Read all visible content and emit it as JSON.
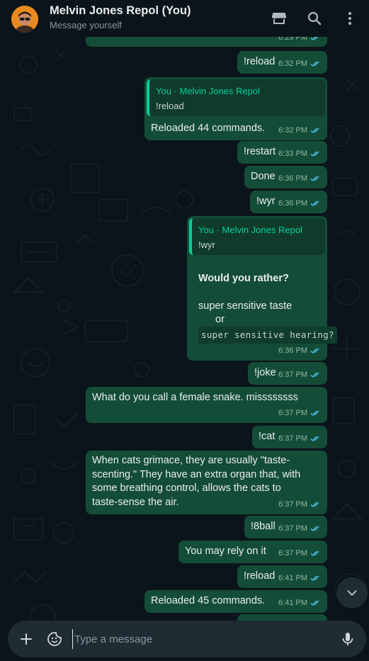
{
  "header": {
    "title": "Melvin Jones Repol (You)",
    "subtitle": "Message yourself",
    "icons": [
      "shop-icon",
      "search-icon",
      "more-vert-icon"
    ]
  },
  "colors": {
    "background": "#0b141a",
    "outgoing_bubble": "#144d37",
    "accent": "#06cf9c",
    "read_ticks": "#53bdeb",
    "composer": "#1f2c33"
  },
  "messages": [
    {
      "time": "6:29 PM"
    },
    {
      "text": "!reload",
      "time": "6:32 PM"
    },
    {
      "quote_author": "You · Melvin Jones Repol",
      "quote_text": "!reload",
      "text": "Reloaded 44 commands.",
      "time": "6:32 PM"
    },
    {
      "text": "!restart",
      "time": "6:33 PM"
    },
    {
      "text": "Done",
      "time": "6:36 PM"
    },
    {
      "text": "!wyr",
      "time": "6:36 PM"
    },
    {
      "quote_author": "You · Melvin Jones Repol",
      "quote_text": "!wyr",
      "title": "Would you rather?",
      "option_a": "super sensitive taste",
      "or": "or",
      "option_b": "super  sensitive  hearing?",
      "time": "6:36 PM"
    },
    {
      "text": "!joke",
      "time": "6:37 PM"
    },
    {
      "text": "What do you call a female snake. missssssss",
      "time": "6:37 PM"
    },
    {
      "text": "!cat",
      "time": "6:37 PM"
    },
    {
      "lines": [
        "When cats grimace, they are usually \"taste-",
        "scenting.\" They have an extra organ that, with",
        "some breathing control, allows the cats to",
        "taste-sense the air."
      ],
      "time": "6:37 PM"
    },
    {
      "text": "!8ball",
      "time": "6:37 PM"
    },
    {
      "text": "You may rely on it",
      "time": "6:37 PM"
    },
    {
      "text": "!reload",
      "time": "6:41 PM"
    },
    {
      "text": "Reloaded 45 commands.",
      "time": "6:41 PM"
    }
  ],
  "composer": {
    "placeholder": "Type a message",
    "icons": [
      "plus-icon",
      "sticker-icon",
      "mic-icon"
    ]
  }
}
